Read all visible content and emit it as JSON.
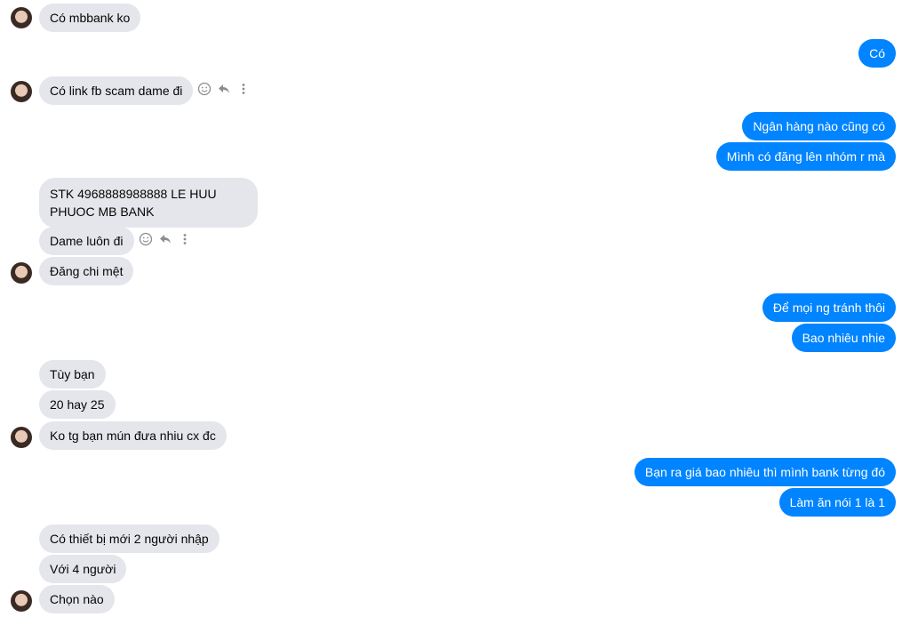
{
  "messages": {
    "m1": "Có mbbank ko",
    "m2": "Có",
    "m3": "Có link fb scam dame đi",
    "m4": "Ngân hàng nào cũng có",
    "m5": "Mình có đăng lên nhóm r mà",
    "m6": "STK 4968888988888 LE HUU PHUOC MB BANK",
    "m7": "Dame luôn đi",
    "m8": "Đăng chi mệt",
    "m9": "Để mọi ng tránh thôi",
    "m10": "Bao nhiêu nhie",
    "m11": "Tùy bạn",
    "m12": "20 hay 25",
    "m13": "Ko tg bạn mún đưa nhiu cx đc",
    "m14": "Bạn ra giá bao nhiêu thì mình bank từng đó",
    "m15": "Làm ăn nói 1 là 1",
    "m16": "Có thiết bị mới 2 người nhập",
    "m17": "Với 4 người",
    "m18": "Chọn nào"
  },
  "icons": {
    "react": "smiley-icon",
    "reply": "reply-icon",
    "more": "more-vertical-icon"
  },
  "colors": {
    "outgoing": "#0084ff",
    "incoming": "#e4e6eb"
  }
}
